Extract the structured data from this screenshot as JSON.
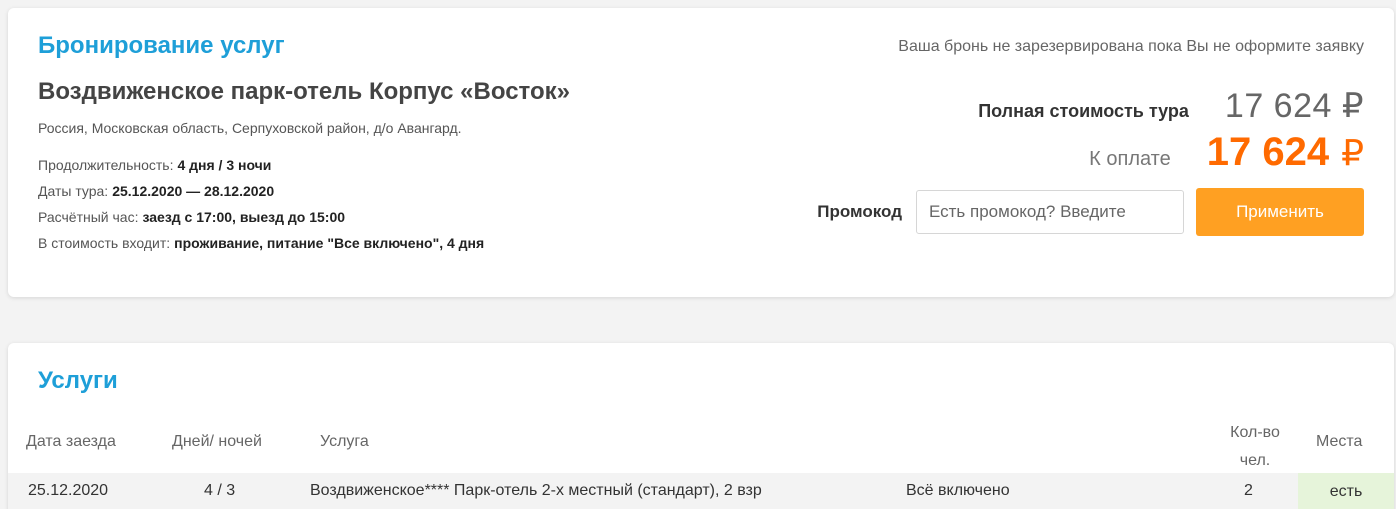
{
  "booking": {
    "title": "Бронирование услуг",
    "notice": "Ваша бронь не зарезервирована пока Вы не оформите заявку",
    "hotel_name": "Воздвиженское парк-отель Корпус «Восток»",
    "address": "Россия, Московская область, Серпуховской район, д/о Авангард.",
    "info": [
      {
        "label": "Продолжительность:",
        "value": "4 дня / 3 ночи"
      },
      {
        "label": "Даты тура:",
        "value": "25.12.2020 — 28.12.2020"
      },
      {
        "label": "Расчётный час:",
        "value": "заезд с 17:00, выезд до 15:00"
      },
      {
        "label": "В стоимость входит:",
        "value": "проживание, питание \"Все включено\", 4 дня"
      }
    ],
    "total_label": "Полная стоимость тура",
    "total_value": "17 624 ₽",
    "pay_label": "К оплате",
    "pay_value": "17 624",
    "pay_currency": "₽",
    "promo_label": "Промокод",
    "promo_placeholder": "Есть промокод? Введите",
    "promo_button": "Применить"
  },
  "services": {
    "title": "Услуги",
    "columns": {
      "date": "Дата заезда",
      "days": "Дней/ ночей",
      "service": "Услуга",
      "qty_line1": "Кол-во",
      "qty_line2": "чел.",
      "places": "Места"
    },
    "rows": [
      {
        "date": "25.12.2020",
        "days": "4 / 3",
        "service": "Воздвиженское**** Парк-отель  2-х местный (стандарт), 2 взр",
        "meal": "Всё включено",
        "qty": "2",
        "places": "есть"
      }
    ]
  },
  "colors": {
    "accent_blue": "#1e9fd8",
    "price_orange": "#ff6a00",
    "button_orange": "#ffa022",
    "places_green": "#e6f4da"
  }
}
